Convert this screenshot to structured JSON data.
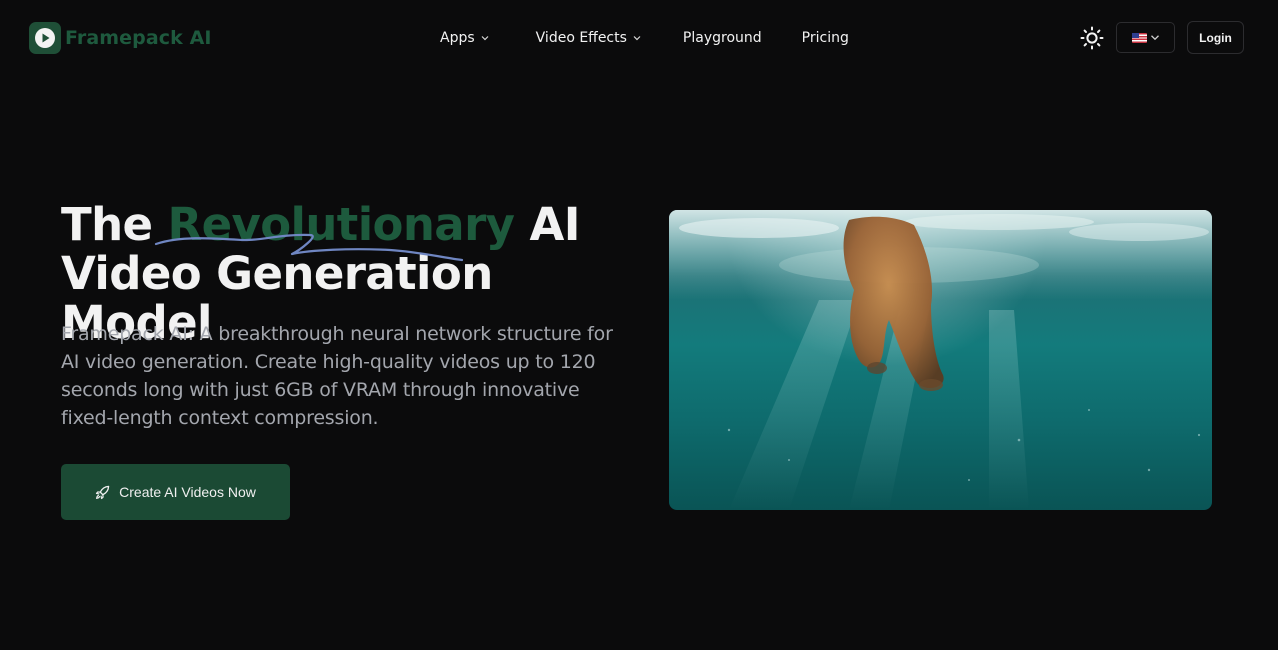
{
  "brand": {
    "name": "Framepack AI"
  },
  "nav": {
    "items": [
      {
        "label": "Apps",
        "has_dropdown": true
      },
      {
        "label": "Video Effects",
        "has_dropdown": true
      },
      {
        "label": "Playground",
        "has_dropdown": false
      },
      {
        "label": "Pricing",
        "has_dropdown": false
      }
    ]
  },
  "header": {
    "theme_icon": "sun-icon",
    "language_flag": "us-flag-icon",
    "login_label": "Login"
  },
  "hero": {
    "title_prefix": "The ",
    "title_accent": "Revolutionary",
    "title_suffix_line1": " AI",
    "title_line2": "Video Generation Model",
    "description": "Framepack AI: A breakthrough neural network structure for AI video generation. Create high-quality videos up to 120 seconds long with just 6GB of VRAM through innovative fixed-length context compression.",
    "cta_label": "Create AI Videos Now",
    "cta_icon": "rocket-icon"
  },
  "colors": {
    "background": "#0b0b0c",
    "accent": "#1d5a3d",
    "cta_bg": "#1b4a34",
    "scribble": "#6f86c2"
  }
}
